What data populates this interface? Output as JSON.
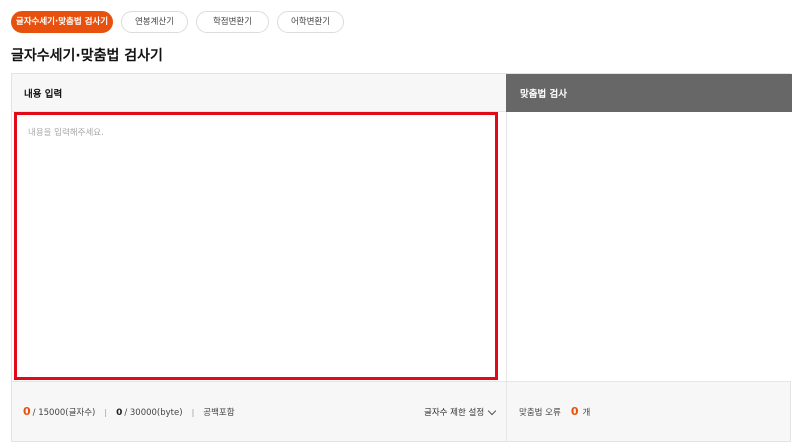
{
  "tabs": [
    {
      "label": "글자수세기·맞춤법 검사기",
      "active": true
    },
    {
      "label": "연봉계산기",
      "active": false
    },
    {
      "label": "학점변환기",
      "active": false
    },
    {
      "label": "어학변환기",
      "active": false
    }
  ],
  "page_title": "글자수세기·맞춤법 검사기",
  "input_panel": {
    "header": "내용 입력",
    "placeholder": "내용을 입력해주세요.",
    "value": ""
  },
  "result_panel": {
    "header": "맞춤법 검사"
  },
  "footer": {
    "char_count": "0",
    "char_limit_text": "/ 15000(글자수)",
    "byte_count": "0",
    "byte_limit_text": "/ 30000(byte)",
    "separator": "|",
    "include_spaces": "공백포함",
    "limit_setting_label": "글자수 제한 설정",
    "error_label": "맞춤법 오류",
    "error_count": "0",
    "error_unit": "개"
  },
  "colors": {
    "accent": "#e8500e",
    "highlight_border": "#e00b16",
    "result_header_bg": "#676767"
  },
  "icons": {
    "limit_setting": "chevron-down-icon"
  }
}
